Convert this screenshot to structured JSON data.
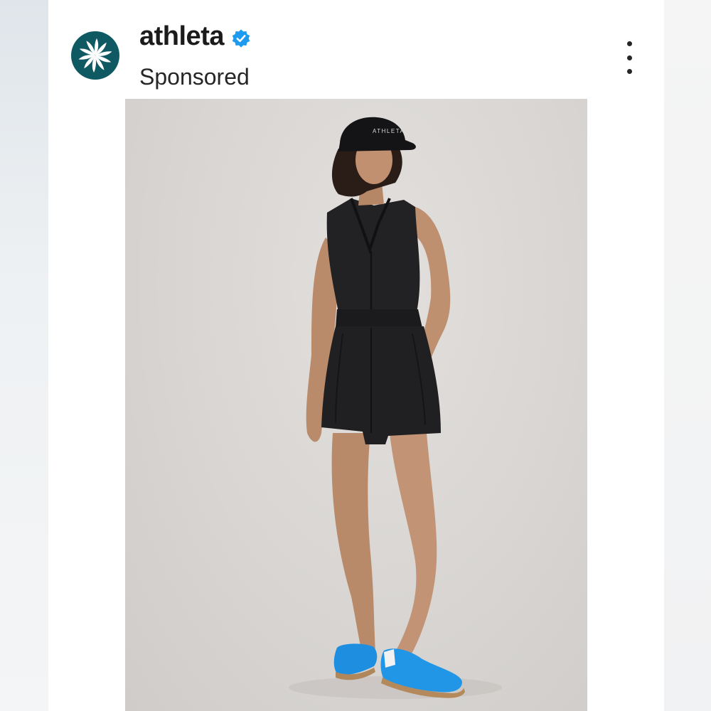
{
  "post": {
    "username": "athleta",
    "label": "Sponsored",
    "verified": true,
    "hat_text": "ATHLETA"
  },
  "icons": {
    "avatar": "pinwheel-logo-icon",
    "verified": "verified-badge-icon",
    "more": "more-vertical-icon"
  },
  "colors": {
    "avatar_bg": "#0f5a62",
    "verified_blue": "#1d9bf0",
    "photo_bg": "#d8d5d2",
    "shoe_blue": "#1e8fe0"
  }
}
